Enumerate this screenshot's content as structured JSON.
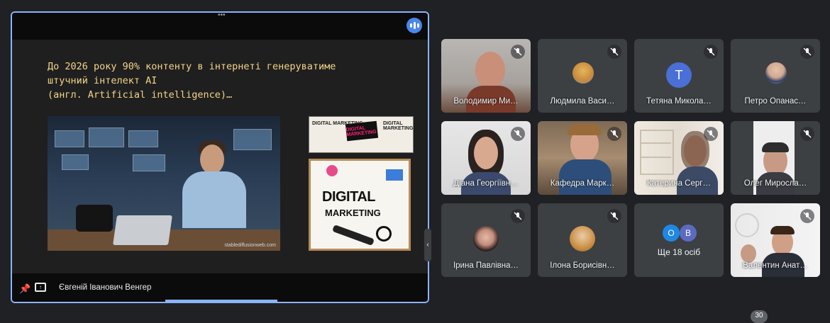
{
  "presentation": {
    "slide_lines": [
      "До 2026 року 90% контенту в інтернеті генеруватиме",
      "штучний інтелект AI",
      "(англ. Artificial intelligence)…"
    ],
    "watermark": "stablediffusionweb.com",
    "small_image_texts": [
      "DIGITAL MARKETING",
      "DIGITAL MARKETING",
      "DIGITAL MARKETING"
    ],
    "big_image_line1": "DIGITAL",
    "big_image_line2": "MARKETING",
    "presenter_name": "Євгеній Іванович Венгер"
  },
  "participants": [
    {
      "name": "Володимир Ми…",
      "type": "video",
      "muted": true
    },
    {
      "name": "Людмила Васи…",
      "type": "photo",
      "muted": true
    },
    {
      "name": "Тетяна Микола…",
      "type": "letter",
      "letter": "T",
      "color": "#4a6fd6",
      "muted": true
    },
    {
      "name": "Петро Опанас…",
      "type": "photo",
      "muted": true
    },
    {
      "name": "Діана Георгіївн…",
      "type": "video",
      "muted": true
    },
    {
      "name": "Кафедра Марк…",
      "type": "video",
      "muted": true
    },
    {
      "name": "Катерина Серг…",
      "type": "video",
      "muted": true
    },
    {
      "name": "Олег Миросла…",
      "type": "video",
      "muted": true
    },
    {
      "name": "Ірина Павлівна…",
      "type": "photo",
      "muted": true
    },
    {
      "name": "Ілона Борисівн…",
      "type": "photo",
      "muted": true
    },
    {
      "name": "Валентин Анат…",
      "type": "video",
      "muted": true
    }
  ],
  "more_tile": {
    "label": "Ще 18 осіб",
    "letters": [
      "O",
      "B"
    ],
    "colors": [
      "#1e88e5",
      "#5c6bc0"
    ]
  },
  "participant_count": "30",
  "colors": {
    "accent": "#8ab4f8",
    "background": "#202124",
    "tile": "#3c4043",
    "slide_text": "#f3d58a"
  }
}
